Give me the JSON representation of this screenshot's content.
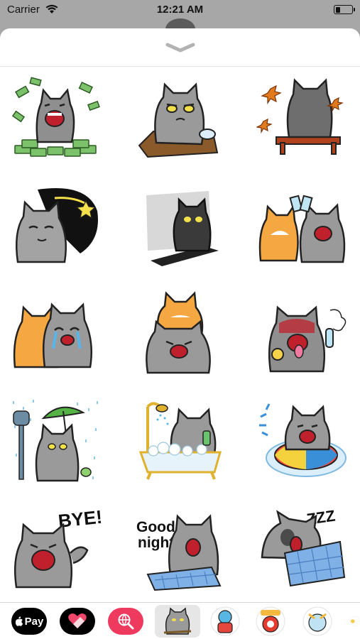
{
  "status_bar": {
    "carrier": "Carrier",
    "time": "12:21 AM"
  },
  "sheet": {
    "collapse_icon": "chevron-down-icon"
  },
  "stickers": [
    {
      "name": "cat money"
    },
    {
      "name": "cat grumpy mat"
    },
    {
      "name": "cat autumn bench"
    },
    {
      "name": "cat shooting star"
    },
    {
      "name": "cat dark sitting"
    },
    {
      "name": "cat cheers"
    },
    {
      "name": "cat hugging crying"
    },
    {
      "name": "cat hug"
    },
    {
      "name": "cat hot sweating"
    },
    {
      "name": "cat bus stop rain"
    },
    {
      "name": "cat bathtub"
    },
    {
      "name": "cat swim ring"
    },
    {
      "name": "cat bye",
      "text": "BYE!"
    },
    {
      "name": "cat good night",
      "text_line1": "Good",
      "text_line2": "night"
    },
    {
      "name": "cat sleeping",
      "text": "ZZZ"
    }
  ],
  "dock": {
    "apple_pay_label": "Pay",
    "items": [
      "apple-pay",
      "digital-touch",
      "image-search",
      "cat-sticker-pack",
      "app-2",
      "app-3",
      "app-4"
    ]
  },
  "colors": {
    "cat_gray": "#8f8f8f",
    "cat_orange": "#f5a742",
    "accent_pink": "#ee3a5f"
  }
}
